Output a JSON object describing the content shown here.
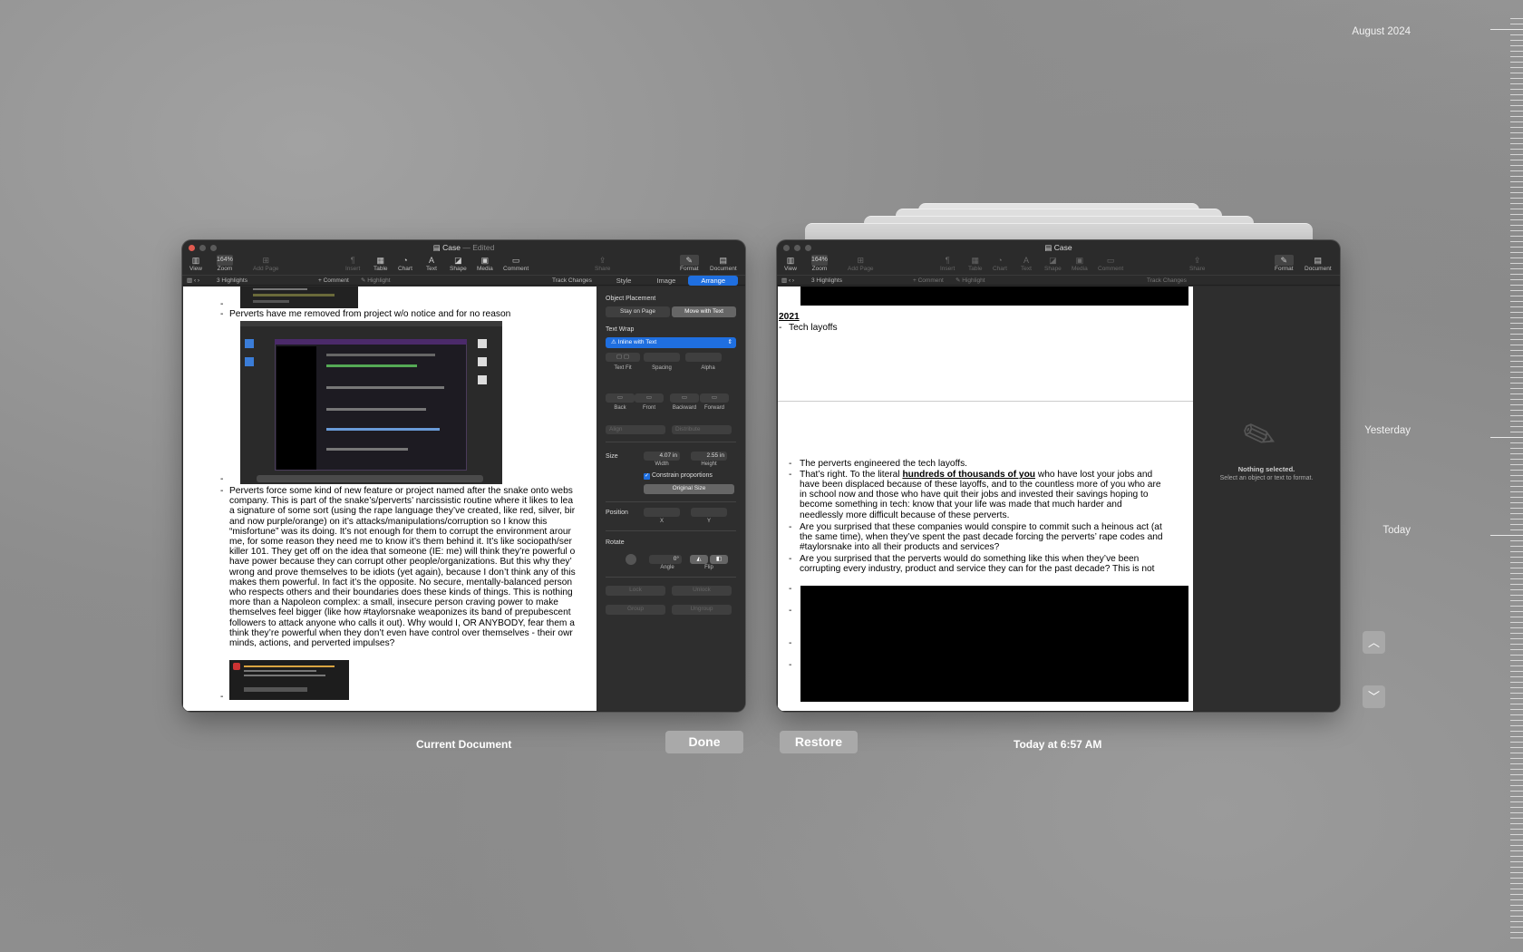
{
  "timeline": {
    "labels": [
      "August 2024",
      "Yesterday",
      "Today"
    ]
  },
  "left_window": {
    "title": "Case",
    "edited": "— Edited",
    "toolbar": [
      "View",
      "Zoom",
      "Add Page",
      "Insert",
      "Table",
      "Chart",
      "Text",
      "Shape",
      "Media",
      "Comment",
      "Share",
      "Format",
      "Document"
    ],
    "zoom": "164%",
    "highlights": "3 Highlights",
    "comment": "+ Comment",
    "highlight": "Highlight",
    "track_changes": "Track Changes",
    "tabs": [
      "Style",
      "Image",
      "Arrange"
    ],
    "inspector": {
      "object_placement": "Object Placement",
      "stay_on_page": "Stay on Page",
      "move_with_text": "Move with Text",
      "text_wrap": "Text Wrap",
      "wrap_value": "Inline with Text",
      "text_fit": "Text Fit",
      "spacing": "Spacing",
      "alpha": "Alpha",
      "back": "Back",
      "front": "Front",
      "backward": "Backward",
      "forward": "Forward",
      "align": "Align",
      "distribute": "Distribute",
      "size": "Size",
      "width_val": "4.07 in",
      "height_val": "2.55 in",
      "width": "Width",
      "height": "Height",
      "constrain": "Constrain proportions",
      "original_size": "Original Size",
      "position": "Position",
      "x": "X",
      "y": "Y",
      "rotate": "Rotate",
      "angle_val": "0°",
      "angle": "Angle",
      "flip": "Flip",
      "lock": "Lock",
      "unlock": "Unlock",
      "group": "Group",
      "ungroup": "Ungroup"
    },
    "doc": {
      "bullet1": "Perverts have me removed from project w/o notice and for no reason",
      "para": [
        "Perverts force some kind of new feature or project named after the snake onto webs",
        "company. This is part of the snake’s/perverts’ narcissistic routine where it likes to lea",
        "a signature of some sort (using the rape language they’ve created, like red, silver, bir",
        "and now purple/orange) on it’s attacks/manipulations/corruption so I know this",
        "“misfortune” was its doing. It’s not enough for them to corrupt the environment arour",
        "me, for some reason they need me to know it’s them behind it. It’s like sociopath/ser",
        "killer 101. They get off on the idea that someone (IE: me) will think they’re powerful o",
        "have power because they can corrupt other people/organizations. But this why they’",
        "wrong and prove themselves to be idiots (yet again), because I don’t think any of this",
        "makes them powerful. In fact it’s the opposite. No secure, mentally-balanced person",
        "who respects others and their boundaries does these kinds of things. This is nothing",
        "more than a Napoleon complex: a small, insecure person craving power to make",
        "themselves feel bigger (like how #taylorsnake weaponizes its band of prepubescent",
        "followers to attack anyone who calls it out). Why would I, OR ANYBODY, fear them a",
        "think they’re powerful when they don’t even have control over themselves - their owr",
        "minds, actions, and perverted impulses?"
      ]
    }
  },
  "right_window": {
    "title": "Case",
    "toolbar": [
      "View",
      "Zoom",
      "Add Page",
      "Insert",
      "Table",
      "Chart",
      "Text",
      "Shape",
      "Media",
      "Comment",
      "Share",
      "Format",
      "Document"
    ],
    "zoom": "164%",
    "highlights": "3 Highlights",
    "comment": "+ Comment",
    "highlight": "Highlight",
    "track_changes": "Track Changes",
    "inspector": {
      "nothing": "Nothing selected.",
      "hint": "Select an object or text to format."
    },
    "doc": {
      "year": "2021",
      "tech": "Tech layoffs",
      "b1": "The perverts engineered the tech layoffs.",
      "b2a": "That’s right. To the literal ",
      "b2u": "hundreds of thousands of you",
      "b2b": " who have lost your jobs and",
      "b2": [
        "have been displaced because of these layoffs, and to the countless more of you who are",
        "in school now and those who have quit their jobs and invested their savings hoping to",
        "become something in tech: know that your life was made that much harder and",
        "needlessly more difficult because of these perverts."
      ],
      "b3": [
        "Are you surprised that these companies would conspire to commit such a heinous act (at",
        "the same time), when they’ve spent the past decade forcing the perverts’ rape codes and",
        "#taylorsnake into all their products and services?"
      ],
      "b4": [
        "Are you surprised that the perverts would do something like this when they’ve been",
        "corrupting every industry, product and service they can for the past decade? This is not"
      ]
    }
  },
  "captions": {
    "current": "Current Document",
    "done": "Done",
    "restore": "Restore",
    "timestamp": "Today at 6:57 AM"
  }
}
